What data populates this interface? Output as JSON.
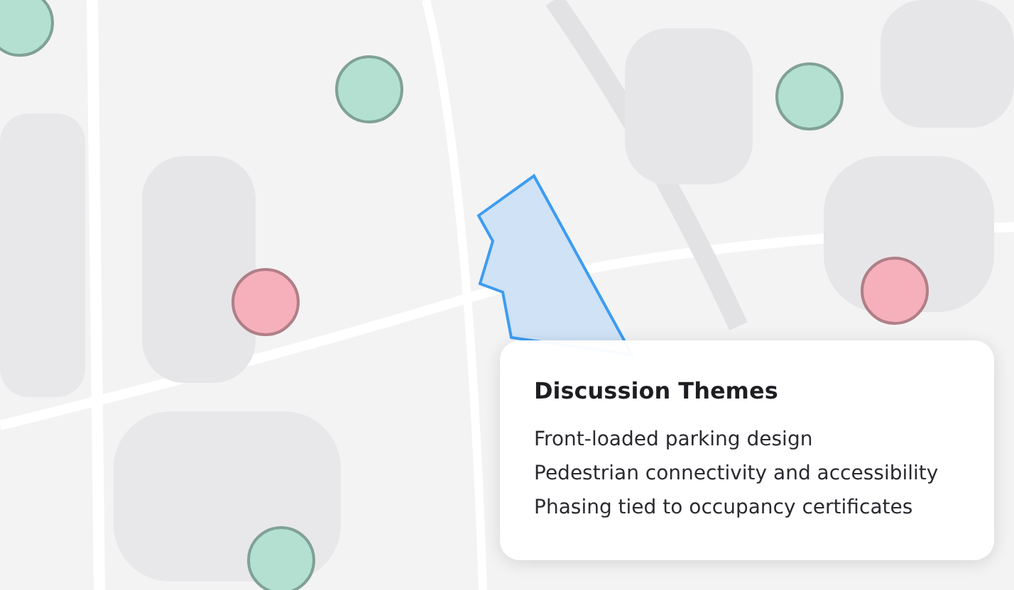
{
  "markers": [
    {
      "color": "#b3e0d1"
    },
    {
      "color": "#b3e0d1"
    },
    {
      "color": "#b3e0d1"
    },
    {
      "color": "#f5b0bb"
    },
    {
      "color": "#f5b0bb"
    },
    {
      "color": "#b3e0d1"
    }
  ],
  "themes_card": {
    "title": "Discussion Themes",
    "items": [
      "Front-loaded parking design",
      "Pedestrian connectivity and accessibility",
      "Phasing tied to occupancy certificates"
    ]
  }
}
